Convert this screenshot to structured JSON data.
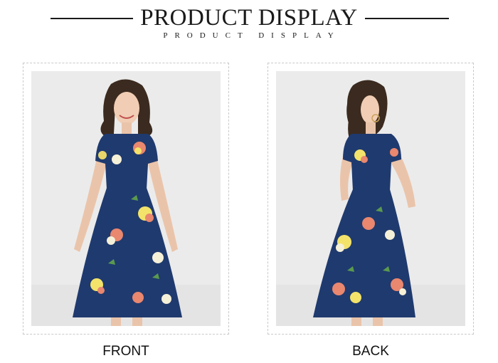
{
  "header": {
    "title": "PRODUCT DISPLAY",
    "subtitle": "PRODUCT DISPLAY"
  },
  "views": [
    {
      "label": "FRONT",
      "icon": "model-front-photo"
    },
    {
      "label": "BACK",
      "icon": "model-back-photo"
    }
  ],
  "colors": {
    "dress": "#1f3a6e",
    "background": "#ebebeb",
    "rule": "#1a1a1a"
  }
}
